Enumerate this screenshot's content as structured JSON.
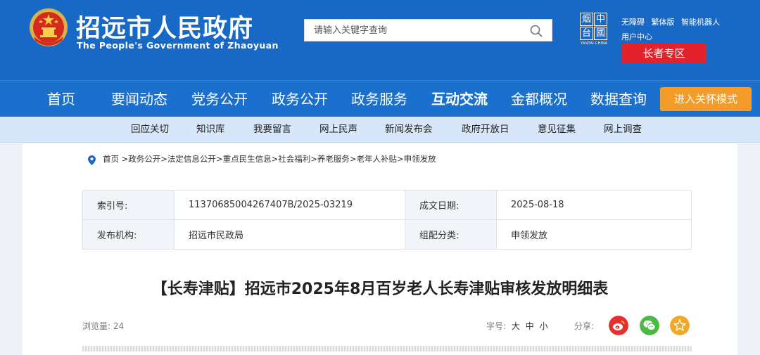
{
  "header": {
    "title": "招远市人民政府",
    "subtitle": "The People's Government of Zhaoyuan",
    "search_placeholder": "请输入关键字查询",
    "brand_chars": [
      "烟",
      "中",
      "台",
      "國"
    ],
    "brand_caption": "YANTAI·CHINA",
    "quick_links": [
      "无障碍",
      "繁体版",
      "智能机器人"
    ],
    "user_center": "用户中心",
    "elder_zone": "长者专区"
  },
  "nav": {
    "items": [
      "首页",
      "要闻动态",
      "党务公开",
      "政务公开",
      "政务服务",
      "互动交流",
      "金都概况",
      "数据查询"
    ],
    "active_index": 5,
    "care_mode": "进入关怀模式"
  },
  "subnav": {
    "items": [
      "回应关切",
      "知识库",
      "我要留言",
      "网上民声",
      "新闻发布会",
      "政府开放日",
      "意见征集",
      "网上调查"
    ]
  },
  "breadcrumb": [
    "首页",
    ">政务公开",
    ">法定信息公开",
    ">重点民生信息",
    ">社会福利",
    ">养老服务",
    ">老年人补贴",
    ">申领发放"
  ],
  "info": {
    "index_label": "索引号:",
    "index_value": "11370685004267407B/2025-03219",
    "date_label": "成文日期:",
    "date_value": "2025-08-18",
    "org_label": "发布机构:",
    "org_value": "招远市民政局",
    "category_label": "组配分类:",
    "category_value": "申领发放"
  },
  "article": {
    "title": "【长寿津贴】招远市2025年8月百岁老人长寿津贴审核发放明细表",
    "views_label": "浏览量: 24",
    "font_label": "字号:",
    "font_sizes": [
      "大",
      "中",
      "小"
    ],
    "share_label": "分享:"
  },
  "colors": {
    "primary_blue": "#1769c5",
    "red": "#e3232c",
    "orange": "#f39c2a",
    "weibo": "#e6302f",
    "wechat": "#4cb944",
    "favorite": "#f1a827"
  }
}
